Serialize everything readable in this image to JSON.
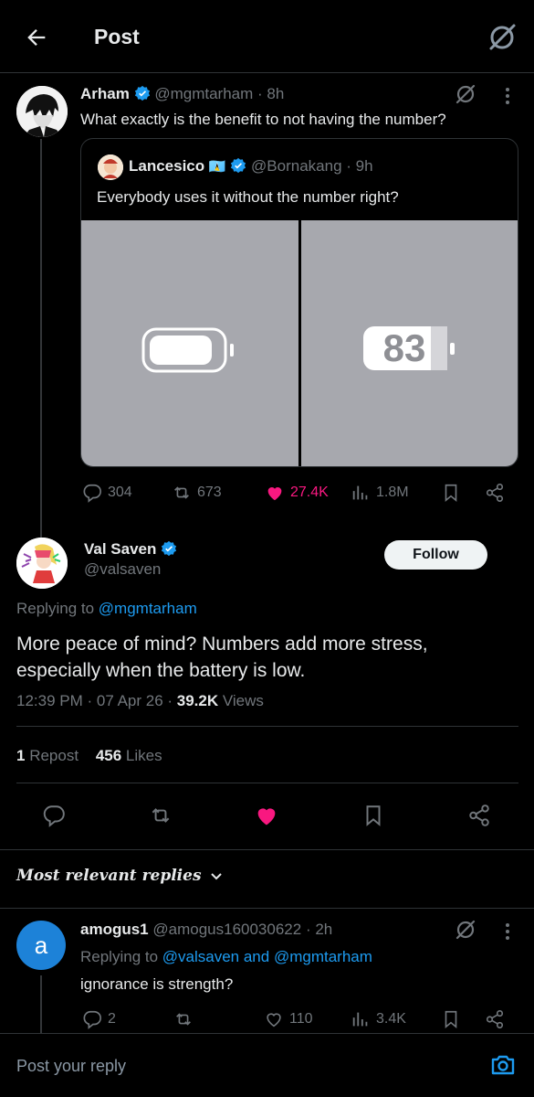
{
  "header": {
    "title": "Post"
  },
  "parent_post": {
    "name": "Arham",
    "handle": "@mgmtarham",
    "time": "· 8h",
    "text": "What exactly is the benefit to not having the number?",
    "stats": {
      "replies": "304",
      "reposts": "673",
      "likes": "27.4K",
      "views": "1.8M"
    }
  },
  "quoted_post": {
    "name": "Lancesico",
    "flag": "🇱🇨",
    "handle": "@Bornakang",
    "time": "· 9h",
    "text": "Everybody uses it without the number right?",
    "battery_number": "83"
  },
  "main_post": {
    "name": "Val Saven",
    "handle": "@valsaven",
    "follow_label": "Follow",
    "replying_prefix": "Replying to ",
    "replying_to": "@mgmtarham",
    "text_line1": "More peace of mind? Numbers add more stress,",
    "text_line2": "especially when the battery is low.",
    "timestamp": "12:39 PM · 07 Apr 26 · ",
    "views_count": "39.2K",
    "views_label": " Views",
    "reposts_count": "1",
    "reposts_label": "Repost",
    "likes_count": "456",
    "likes_label": "Likes"
  },
  "replies_filter": {
    "label": "Most relevant replies"
  },
  "reply1": {
    "avatar_letter": "a",
    "name": "amogus1",
    "handle": "@amogus160030622",
    "time": "· 2h",
    "replying_prefix": "Replying to ",
    "replying_to": "@valsaven and @mgmtarham",
    "text": "ignorance is strength?",
    "stats": {
      "replies": "2",
      "likes": "110",
      "views": "3.4K"
    }
  },
  "composer": {
    "placeholder": "Post your reply"
  },
  "colors": {
    "accent": "#1d9bf0",
    "like": "#f91880",
    "background": "#000000",
    "muted": "#71767b"
  }
}
